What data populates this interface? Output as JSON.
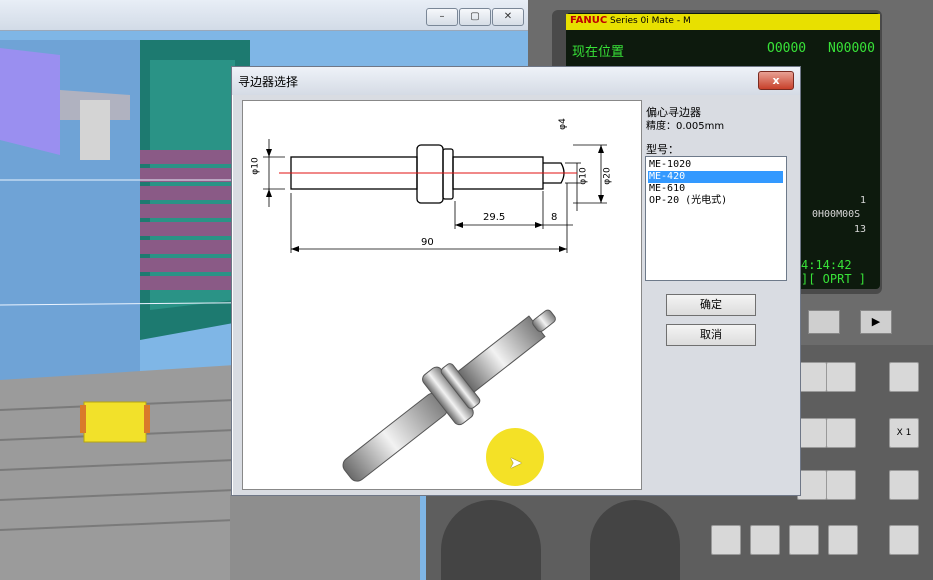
{
  "dialog": {
    "title": "寻边器选择",
    "close_label": "x",
    "info_title": "偏心寻边器",
    "precision": "精度：0.005mm",
    "model_label": "型号：",
    "models": [
      "ME-1020",
      "ME-420",
      "ME-610",
      "OP-20 (光电式)"
    ],
    "selected_index": 1,
    "ok_label": "确定",
    "cancel_label": "取消",
    "dims": {
      "dia_left": "φ10",
      "dia_top": "φ4",
      "dia_mid": "φ10",
      "dia_right": "φ20",
      "len_295": "29.5",
      "len_8": "8",
      "len_90": "90"
    }
  },
  "cnc": {
    "brand": "FANUC",
    "series": "Series 0i Mate - M",
    "pos_label": "现在位置",
    "prog_o": "O0000",
    "prog_n": "N00000",
    "val_1": "1",
    "val_mode": "0H00M00S",
    "val_13": "13",
    "clock": "4:14:42",
    "mode": "][ OPRT ]",
    "key_x1": "X 1"
  },
  "colors": {
    "cnc_text": "#38e238",
    "selection": "#3399ff",
    "dialog_bg": "#d9dce2"
  }
}
